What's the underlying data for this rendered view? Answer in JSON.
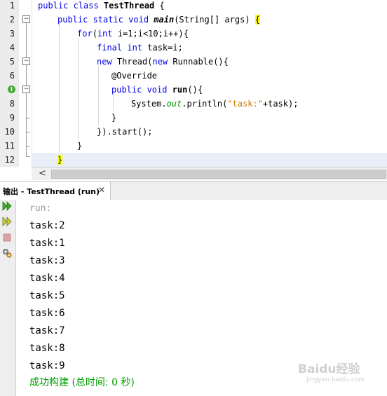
{
  "editor": {
    "line_numbers": [
      "1",
      "2",
      "3",
      "4",
      "5",
      "6",
      "7",
      "8",
      "9",
      "10",
      "11",
      "12"
    ],
    "lines": {
      "l1": {
        "kw": "public class ",
        "name": "TestThread",
        "rest": " {"
      },
      "l2": {
        "kw": "public static void ",
        "name": "main",
        "rest": "(String[] args) ",
        "brace": "{"
      },
      "l3": {
        "kw": "for",
        "p1": "(",
        "kw2": "int",
        "rest": " i=1;i<10;i++){"
      },
      "l4": {
        "kw": "final int",
        "rest": " task=i;"
      },
      "l5": {
        "kw": "new",
        "rest1": " Thread(",
        "kw2": "new",
        "rest2": " Runnable(){"
      },
      "l6": {
        "text": "@Override"
      },
      "l7": {
        "kw": "public void ",
        "name": "run",
        "rest": "(){"
      },
      "l8": {
        "pre": "System.",
        "field": "out",
        "mid": ".println(",
        "str": "\"task:\"",
        "post": "+task);"
      },
      "l9": {
        "text": "}"
      },
      "l10": {
        "text": "}).start();"
      },
      "l11": {
        "text": "}"
      },
      "l12": {
        "text": "}"
      }
    },
    "annotation_icon_glyph": "I",
    "scroll_left_glyph": "<"
  },
  "output": {
    "tab_label": "输出 - TestThread (run)",
    "close_glyph": "✕",
    "lines": [
      "run:",
      "task:2",
      "task:1",
      "task:3",
      "task:4",
      "task:5",
      "task:6",
      "task:7",
      "task:8",
      "task:9"
    ],
    "success": "成功构建 (总时间: 0 秒)"
  },
  "toolbar": {
    "icons": [
      "rerun-icon",
      "rerun-with-args-icon",
      "stop-icon",
      "settings-icon"
    ]
  },
  "watermark": {
    "text": "Baidu经验",
    "sub": "jingyan.baidu.com"
  }
}
